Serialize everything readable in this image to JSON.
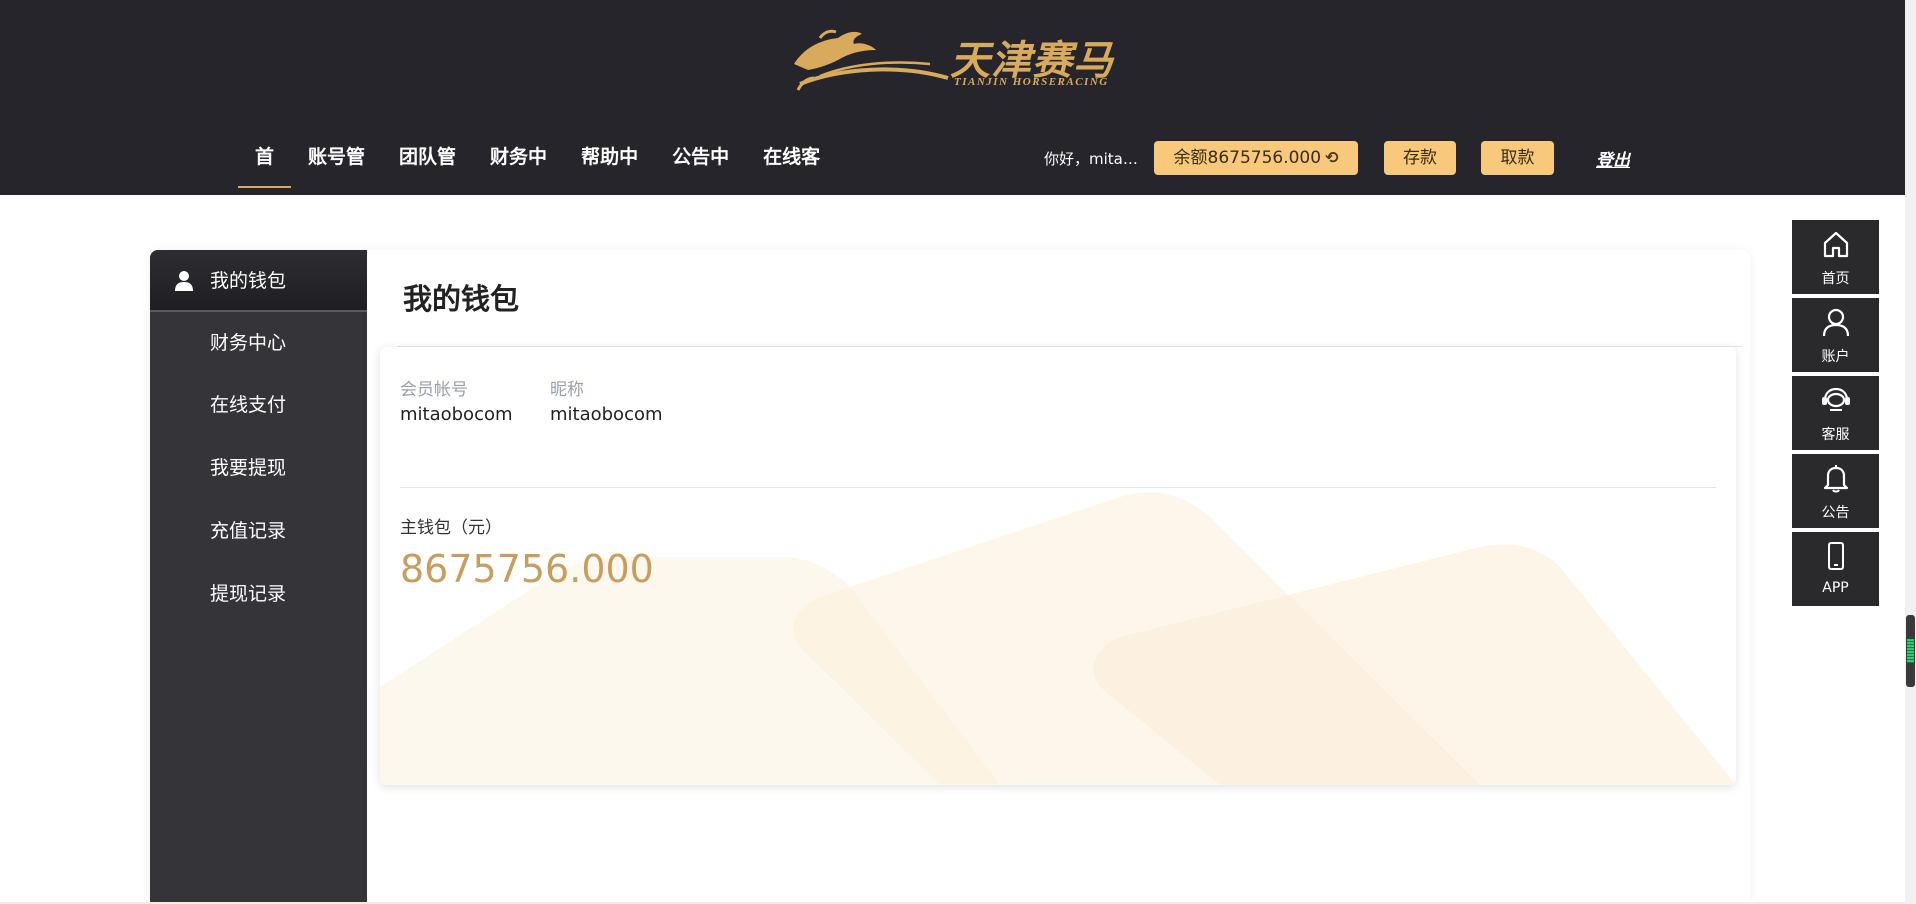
{
  "brand": {
    "name_cn": "天津赛马",
    "name_en": "TIANJIN HORSERACING",
    "gold": "#d9aa5b"
  },
  "nav": {
    "items": [
      {
        "label": "首"
      },
      {
        "label": "账号管"
      },
      {
        "label": "团队管"
      },
      {
        "label": "财务中"
      },
      {
        "label": "帮助中"
      },
      {
        "label": "公告中"
      },
      {
        "label": "在线客"
      }
    ]
  },
  "user": {
    "greeting": "你好，mitao...",
    "balance_label": "余额8675756.000",
    "refresh_icon": "refresh-icon",
    "deposit_label": "存款",
    "withdraw_label": "取款",
    "logout_label": "登出"
  },
  "sidebar": {
    "items": [
      {
        "label": "我的钱包",
        "icon": "user-icon"
      },
      {
        "label": "财务中心"
      },
      {
        "label": "在线支付"
      },
      {
        "label": "我要提现"
      },
      {
        "label": "充值记录"
      },
      {
        "label": "提现记录"
      }
    ]
  },
  "content": {
    "title": "我的钱包",
    "account_label": "会员帐号",
    "account_value": "mitaobocom",
    "nickname_label": "昵称",
    "nickname_value": "mitaobocom",
    "main_wallet_label": "主钱包（元）",
    "main_wallet_amount": "8675756.000"
  },
  "float_bar": {
    "items": [
      {
        "label": "首页",
        "icon": "home-icon"
      },
      {
        "label": "账户",
        "icon": "account-icon"
      },
      {
        "label": "客服",
        "icon": "headset-icon"
      },
      {
        "label": "公告",
        "icon": "bell-icon"
      },
      {
        "label": "APP",
        "icon": "phone-icon"
      }
    ]
  },
  "colors": {
    "header_bg": "#26252b",
    "sidebar_bg": "#353439",
    "pill_bg": "#f8c97a",
    "amount": "#c89d5e"
  }
}
